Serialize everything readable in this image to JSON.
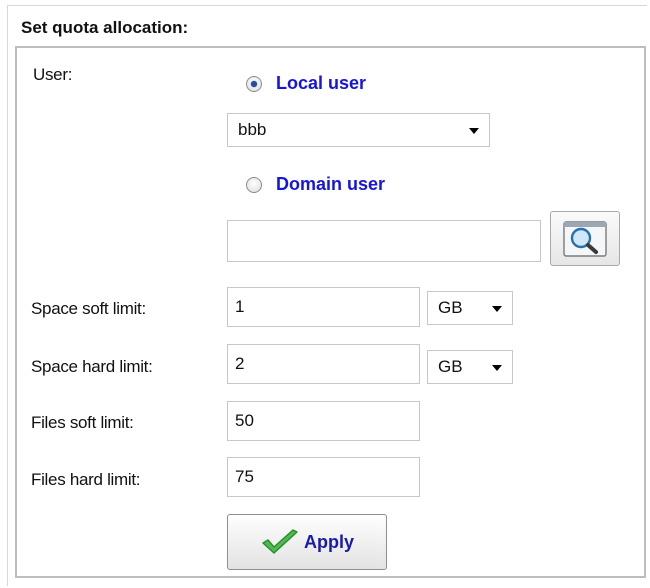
{
  "panel": {
    "title": "Set quota allocation:"
  },
  "user": {
    "label": "User:",
    "local_user_label": "Local user",
    "local_user_selected": "bbb",
    "domain_user_label": "Domain user",
    "domain_user_value": ""
  },
  "space_soft": {
    "label": "Space soft limit:",
    "value": "1",
    "unit": "GB"
  },
  "space_hard": {
    "label": "Space hard limit:",
    "value": "2",
    "unit": "GB"
  },
  "files_soft": {
    "label": "Files soft limit:",
    "value": "50"
  },
  "files_hard": {
    "label": "Files hard limit:",
    "value": "75"
  },
  "apply": {
    "label": "Apply"
  },
  "icons": {
    "search": "magnifier-icon",
    "apply": "checkmark-icon"
  },
  "colors": {
    "link_blue": "#1515e0",
    "border": "#bdbdbd",
    "check_green": "#3fb33f"
  }
}
